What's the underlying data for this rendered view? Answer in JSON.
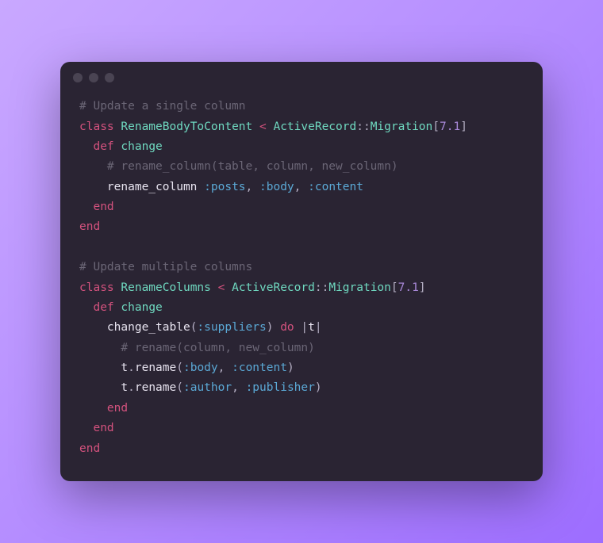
{
  "t": {
    "c1": "# Update a single column",
    "kw_class": "class",
    "cn1": "RenameBodyToContent",
    "lt": "<",
    "ar": "ActiveRecord",
    "cc": "::",
    "mig": "Migration",
    "lb": "[",
    "v": "7.1",
    "rb": "]",
    "kw_def": "def",
    "m_change": "change",
    "c2": "# rename_column(table, column, new_column)",
    "rc": "rename_column",
    "sp": " ",
    "s_posts": ":posts",
    "comma": ",",
    "s_body": ":body",
    "s_content": ":content",
    "kw_end": "end",
    "c3": "# Update multiple columns",
    "cn2": "RenameColumns",
    "ct": "change_table",
    "lp": "(",
    "rp": ")",
    "s_suppliers": ":suppliers",
    "kw_do": "do",
    "pipe": "|",
    "tvar": "t",
    "c4": "# rename(column, new_column)",
    "dot": ".",
    "rename": "rename",
    "s_author": ":author",
    "s_publisher": ":publisher"
  }
}
